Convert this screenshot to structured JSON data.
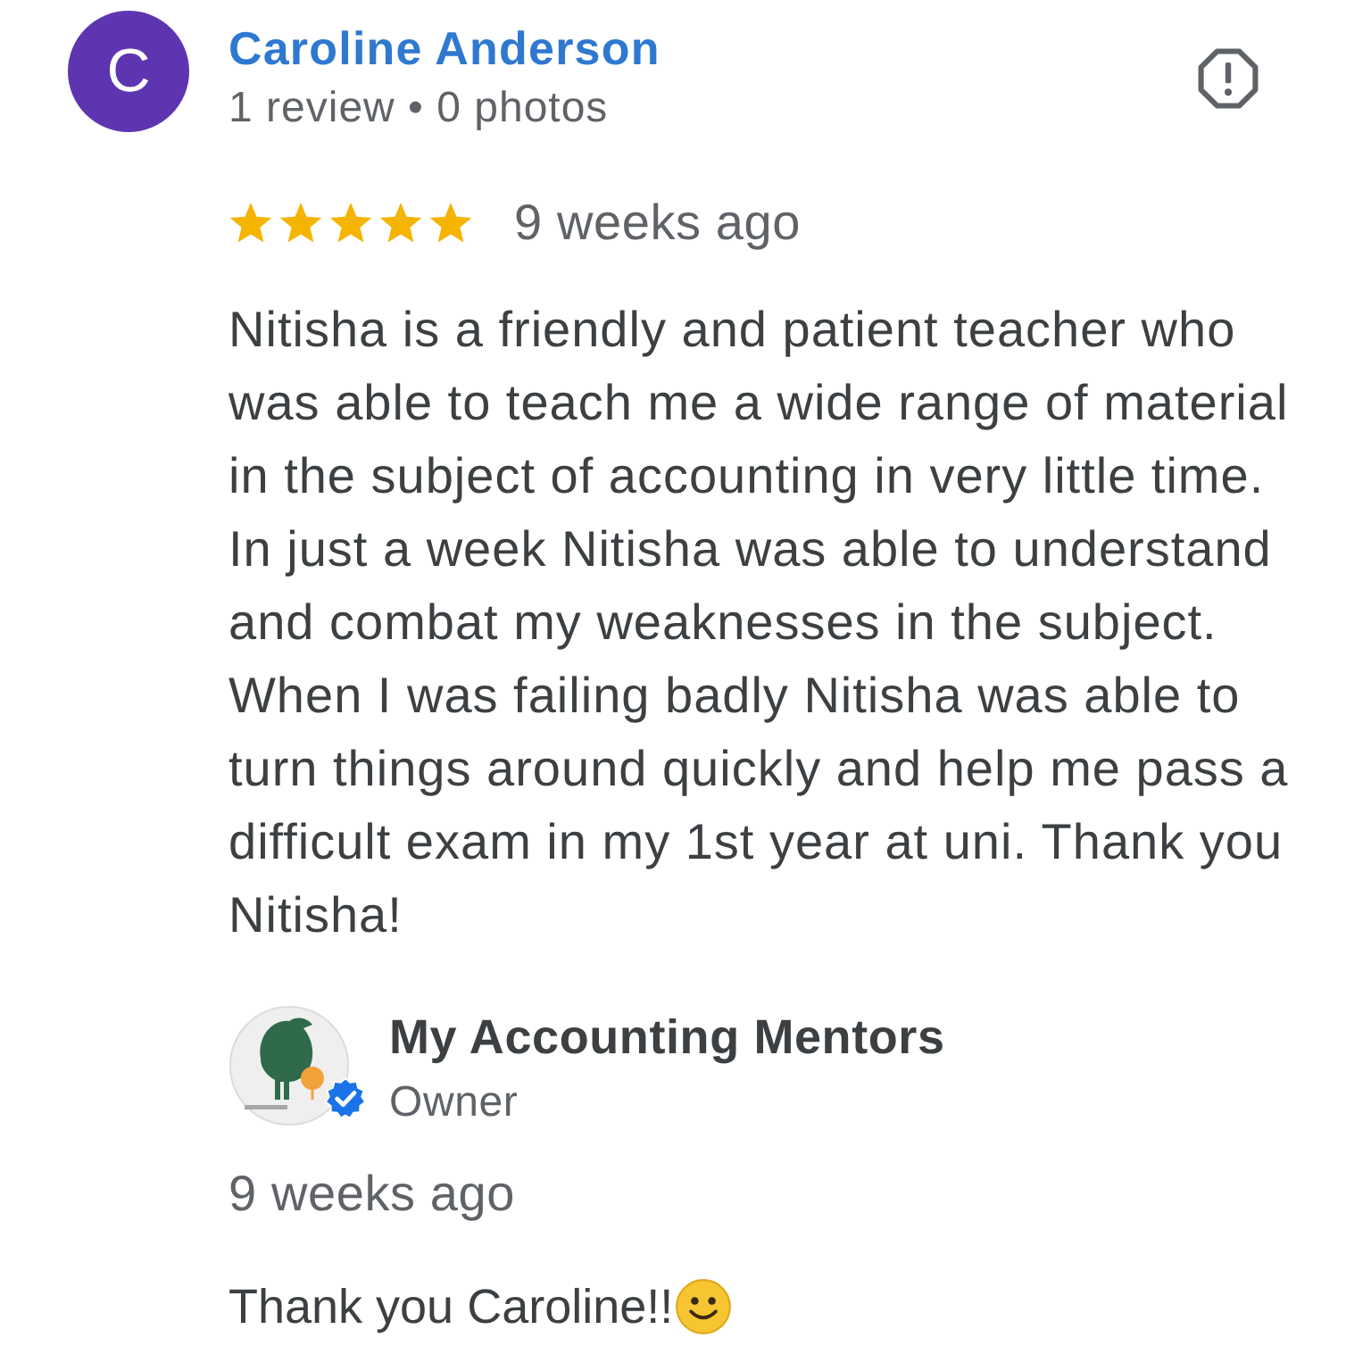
{
  "reviewer": {
    "initial": "C",
    "name": "Caroline Anderson",
    "meta": "1 review • 0 photos"
  },
  "review": {
    "stars": 5,
    "time": "9 weeks ago",
    "text": "Nitisha is a friendly and patient teacher who was able to teach me a wide range of material in the subject of accounting in very little time. In just a week Nitisha was able to understand and combat my weaknesses in the subject.\nWhen I was failing badly Nitisha was able to turn things around quickly and help me pass a difficult exam in my 1st year at uni. Thank you Nitisha!"
  },
  "owner_reply": {
    "name": "My Accounting Mentors",
    "role": "Owner",
    "verified": true,
    "time": "9 weeks ago",
    "text": "Thank you Caroline!!"
  }
}
